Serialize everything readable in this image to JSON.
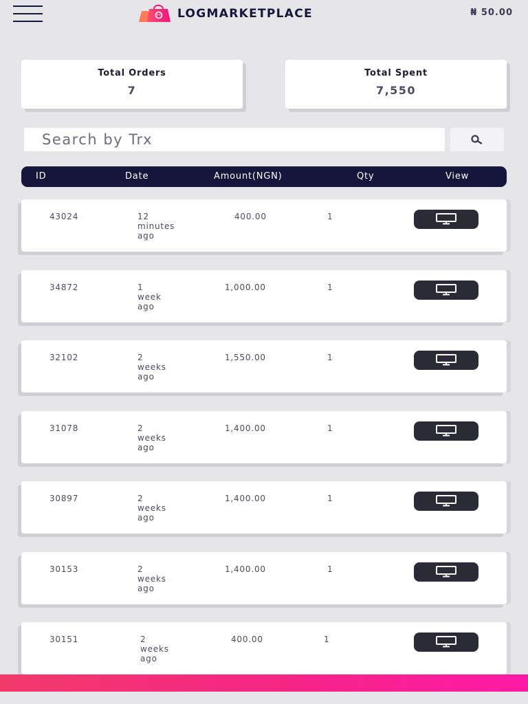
{
  "header": {
    "brand": "LOGMARKETPLACE",
    "balance": "₦ 50.00",
    "menu_icon": "hamburger-menu-icon",
    "logo_icon": "shopping-bag-icon"
  },
  "stats": {
    "total_orders_label": "Total Orders",
    "total_orders_value": "7",
    "total_spent_label": "Total Spent",
    "total_spent_value": "7,550"
  },
  "search": {
    "placeholder": "Search by Trx",
    "icon": "search-icon"
  },
  "table": {
    "columns": [
      "ID",
      "Date",
      "Amount(NGN)",
      "Qty",
      "View"
    ],
    "rows": [
      {
        "id": "43024",
        "date": [
          "12",
          "minutes",
          "ago"
        ],
        "amount": "400.00",
        "qty": "1"
      },
      {
        "id": "34872",
        "date": [
          "1",
          "week",
          "ago"
        ],
        "amount": "1,000.00",
        "qty": "1"
      },
      {
        "id": "32102",
        "date": [
          "2",
          "weeks",
          "ago"
        ],
        "amount": "1,550.00",
        "qty": "1"
      },
      {
        "id": "31078",
        "date": [
          "2",
          "weeks",
          "ago"
        ],
        "amount": "1,400.00",
        "qty": "1"
      },
      {
        "id": "30897",
        "date": [
          "2",
          "weeks",
          "ago"
        ],
        "amount": "1,400.00",
        "qty": "1"
      },
      {
        "id": "30153",
        "date": [
          "2",
          "weeks",
          "ago"
        ],
        "amount": "1,400.00",
        "qty": "1"
      },
      {
        "id": "30151",
        "date": [
          "2",
          "weeks",
          "ago"
        ],
        "amount": "400.00",
        "qty": "1"
      }
    ],
    "view_icon": "monitor-icon"
  },
  "colors": {
    "navy": "#15163c",
    "accent": "#f52587",
    "button": "#2a2b36"
  }
}
